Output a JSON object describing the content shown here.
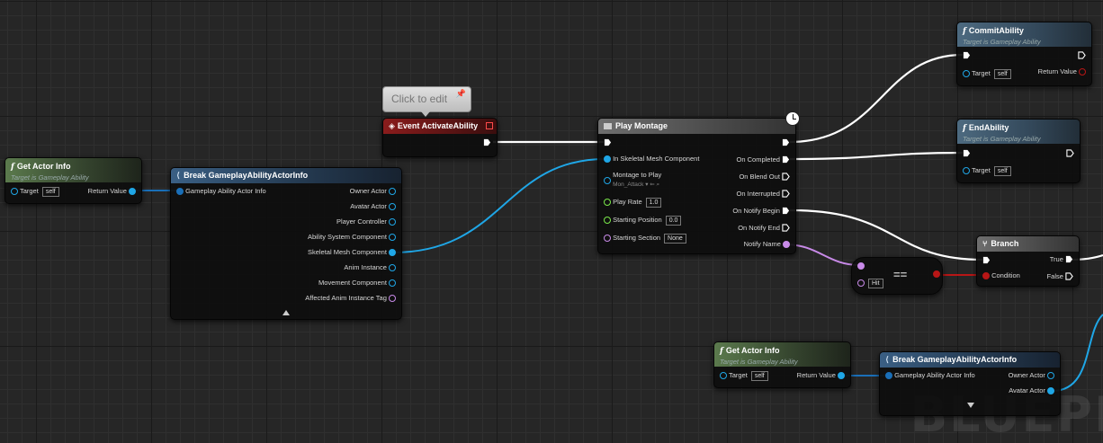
{
  "colors": {
    "exec_wire": "#ffffff",
    "object_wire": "#1fa6e6",
    "name_wire": "#c88ae8",
    "bool_wire": "#b81616",
    "struct_wire": "#1a6fb8"
  },
  "watermark": "BLUEPRINT",
  "comment_bubble": {
    "text": "Click to edit"
  },
  "get_actor_info_1": {
    "title": "Get Actor Info",
    "subtitle": "Target is Gameplay Ability",
    "target_label": "Target",
    "target_value": "self",
    "return_label": "Return Value"
  },
  "break_info_1": {
    "title": "Break GameplayAbilityActorInfo",
    "input_label": "Gameplay Ability Actor Info",
    "outputs": [
      "Owner Actor",
      "Avatar Actor",
      "Player Controller",
      "Ability System Component",
      "Skeletal Mesh Component",
      "Anim Instance",
      "Movement Component",
      "Affected Anim Instance Tag"
    ]
  },
  "event_activate": {
    "title": "Event ActivateAbility"
  },
  "play_montage": {
    "title": "Play Montage",
    "inputs": {
      "mesh": "In Skeletal Mesh Component",
      "montage": "Montage to Play",
      "montage_value": "Mon_Attack",
      "play_rate": "Play Rate",
      "play_rate_value": "1.0",
      "start_pos": "Starting Position",
      "start_pos_value": "0.0",
      "start_section": "Starting Section",
      "start_section_value": "None"
    },
    "outputs": [
      "On Completed",
      "On Blend Out",
      "On Interrupted",
      "On Notify Begin",
      "On Notify End",
      "Notify Name"
    ]
  },
  "commit_ability": {
    "title": "CommitAbility",
    "subtitle": "Target is Gameplay Ability",
    "target_label": "Target",
    "target_value": "self",
    "return_label": "Return Value"
  },
  "end_ability": {
    "title": "EndAbility",
    "subtitle": "Target is Gameplay Ability",
    "target_label": "Target",
    "target_value": "self"
  },
  "branch": {
    "title": "Branch",
    "condition_label": "Condition",
    "true_label": "True",
    "false_label": "False"
  },
  "equal_node": {
    "operator": "==",
    "value": "Hit"
  },
  "get_actor_info_2": {
    "title": "Get Actor Info",
    "subtitle": "Target is Gameplay Ability",
    "target_label": "Target",
    "target_value": "self",
    "return_label": "Return Value"
  },
  "break_info_2": {
    "title": "Break GameplayAbilityActorInfo",
    "input_label": "Gameplay Ability Actor Info",
    "outputs": [
      "Owner Actor",
      "Avatar Actor"
    ]
  }
}
